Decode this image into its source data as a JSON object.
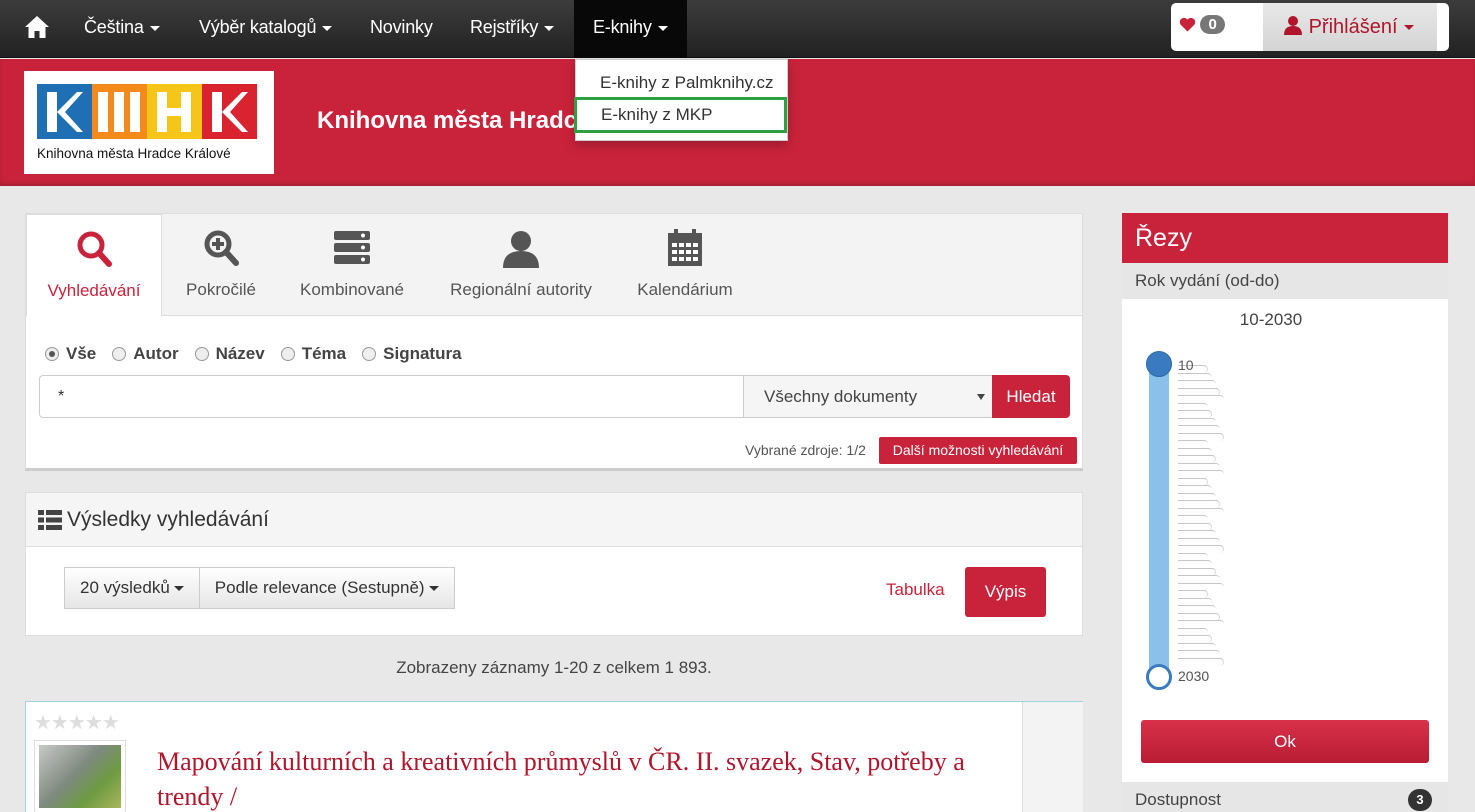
{
  "navbar": {
    "items": [
      {
        "label": "Čeština",
        "dropdown": true
      },
      {
        "label": "Výběr katalogů",
        "dropdown": true
      },
      {
        "label": "Novinky",
        "dropdown": false
      },
      {
        "label": "Rejstříky",
        "dropdown": true
      },
      {
        "label": "E-knihy",
        "dropdown": true,
        "active": true
      }
    ],
    "favorites_count": "0",
    "login_label": "Přihlášení"
  },
  "ebooks_menu": {
    "items": [
      "E-knihy z Palmknihy.cz",
      "E-knihy z MKP"
    ],
    "highlighted_index": 1
  },
  "header": {
    "logo_text": "Knihovna města Hradce Králové",
    "logo_letters": [
      "K",
      "M",
      "H",
      "K"
    ],
    "site_title": "Knihovna města Hradc"
  },
  "search": {
    "tabs": [
      {
        "label": "Vyhledávání",
        "icon": "search-icon",
        "active": true
      },
      {
        "label": "Pokročilé",
        "icon": "zoom-plus-icon",
        "active": false
      },
      {
        "label": "Kombinované",
        "icon": "server-stack-icon",
        "active": false
      },
      {
        "label": "Regionální autority",
        "icon": "user-icon",
        "active": false
      },
      {
        "label": "Kalendárium",
        "icon": "calendar-icon",
        "active": false
      }
    ],
    "fields": [
      {
        "label": "Vše",
        "checked": true
      },
      {
        "label": "Autor",
        "checked": false
      },
      {
        "label": "Název",
        "checked": false
      },
      {
        "label": "Téma",
        "checked": false
      },
      {
        "label": "Signatura",
        "checked": false
      }
    ],
    "query": "*",
    "document_type": "Všechny dokumenty",
    "submit_label": "Hledat",
    "sources_text": "Vybrané zdroje: 1/2",
    "more_options_label": "Další možnosti vyhledávání"
  },
  "results": {
    "heading": "Výsledky vyhledávání",
    "per_page": "20 výsledků",
    "sort": "Podle relevance (Sestupně)",
    "view_table": "Tabulka",
    "view_list": "Výpis",
    "summary": "Zobrazeny záznamy 1-20 z celkem 1 893.",
    "records": [
      {
        "title": "Mapování kulturních a kreativních průmyslů v ČR. II. svazek, Stav, potřeby a trendy /",
        "rating": 0,
        "stars": "★★★★★"
      }
    ]
  },
  "facets": {
    "title": "Řezy",
    "year_facet_label": "Rok vydání (od-do)",
    "year_range": "10-2030",
    "year_min_label": "10",
    "year_max_label": "2030",
    "apply_label": "Ok",
    "availability_label": "Dostupnost",
    "availability_count": "3"
  },
  "colors": {
    "brand_red": "#c9233b",
    "highlight_green": "#2ea043",
    "slider_blue": "#8ac0ea"
  }
}
